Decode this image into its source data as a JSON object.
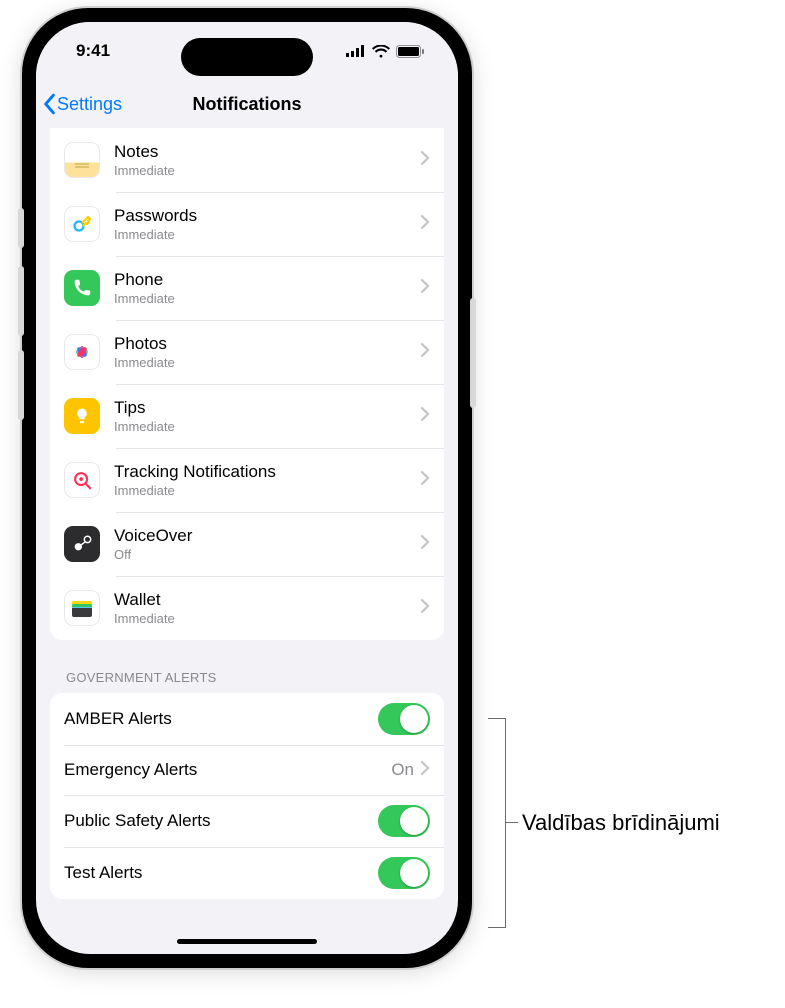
{
  "status": {
    "time": "9:41"
  },
  "nav": {
    "back": "Settings",
    "title": "Notifications"
  },
  "apps": [
    {
      "name": "Notes",
      "sub": "Immediate",
      "icon": "notes"
    },
    {
      "name": "Passwords",
      "sub": "Immediate",
      "icon": "passwords"
    },
    {
      "name": "Phone",
      "sub": "Immediate",
      "icon": "phone"
    },
    {
      "name": "Photos",
      "sub": "Immediate",
      "icon": "photos"
    },
    {
      "name": "Tips",
      "sub": "Immediate",
      "icon": "tips"
    },
    {
      "name": "Tracking Notifications",
      "sub": "Immediate",
      "icon": "tracking"
    },
    {
      "name": "VoiceOver",
      "sub": "Off",
      "icon": "voiceover"
    },
    {
      "name": "Wallet",
      "sub": "Immediate",
      "icon": "wallet"
    }
  ],
  "gov": {
    "header": "Government Alerts",
    "items": [
      {
        "label": "AMBER Alerts",
        "type": "switch",
        "on": true
      },
      {
        "label": "Emergency Alerts",
        "type": "link",
        "value": "On"
      },
      {
        "label": "Public Safety Alerts",
        "type": "switch",
        "on": true
      },
      {
        "label": "Test Alerts",
        "type": "switch",
        "on": true
      }
    ]
  },
  "callout": {
    "label": "Valdības brīdinājumi"
  }
}
